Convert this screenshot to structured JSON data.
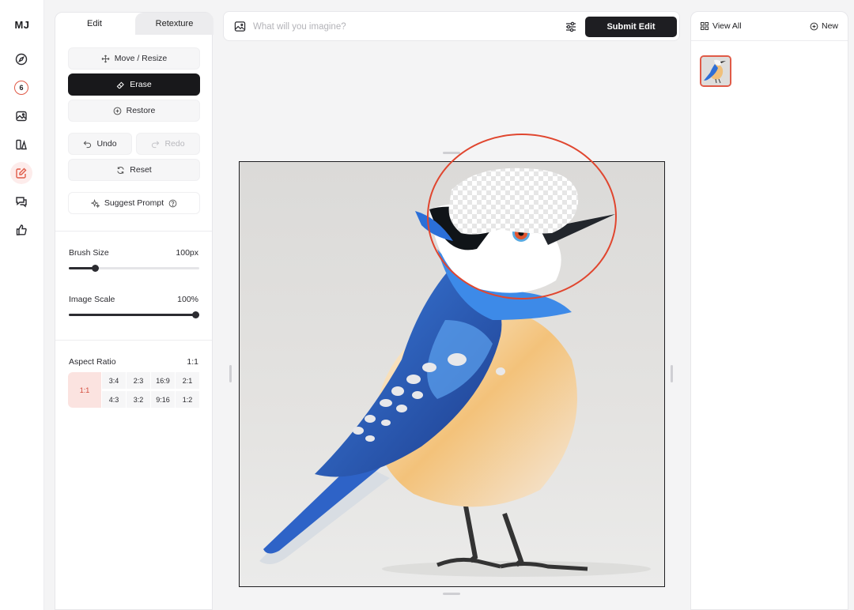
{
  "rail": {
    "logo": "MJ",
    "badge_count": "6",
    "items": [
      "compass-icon",
      "badge",
      "image-icon",
      "shapes-icon",
      "edit-icon",
      "chat-icon",
      "thumbs-up-icon"
    ],
    "active": "edit-icon"
  },
  "tabs": {
    "edit": "Edit",
    "retexture": "Retexture"
  },
  "tools": {
    "move_resize": "Move / Resize",
    "erase": "Erase",
    "restore": "Restore",
    "undo": "Undo",
    "redo": "Redo",
    "reset": "Reset",
    "suggest_prompt": "Suggest Prompt"
  },
  "brush": {
    "label": "Brush Size",
    "value_text": "100px",
    "level": 0.2
  },
  "scale": {
    "label": "Image Scale",
    "value_text": "100%",
    "level": 1.0
  },
  "aspect": {
    "label": "Aspect Ratio",
    "value": "1:1",
    "selected": "1:1",
    "row1": [
      "3:4",
      "2:3",
      "16:9",
      "2:1"
    ],
    "row2": [
      "4:3",
      "3:2",
      "9:16",
      "1:2"
    ]
  },
  "prompt": {
    "placeholder": "What will you imagine?",
    "value": "",
    "submit": "Submit Edit"
  },
  "right": {
    "view_all": "View All",
    "new": "New"
  },
  "colors": {
    "accent": "#e05a47",
    "dark": "#18181b"
  }
}
